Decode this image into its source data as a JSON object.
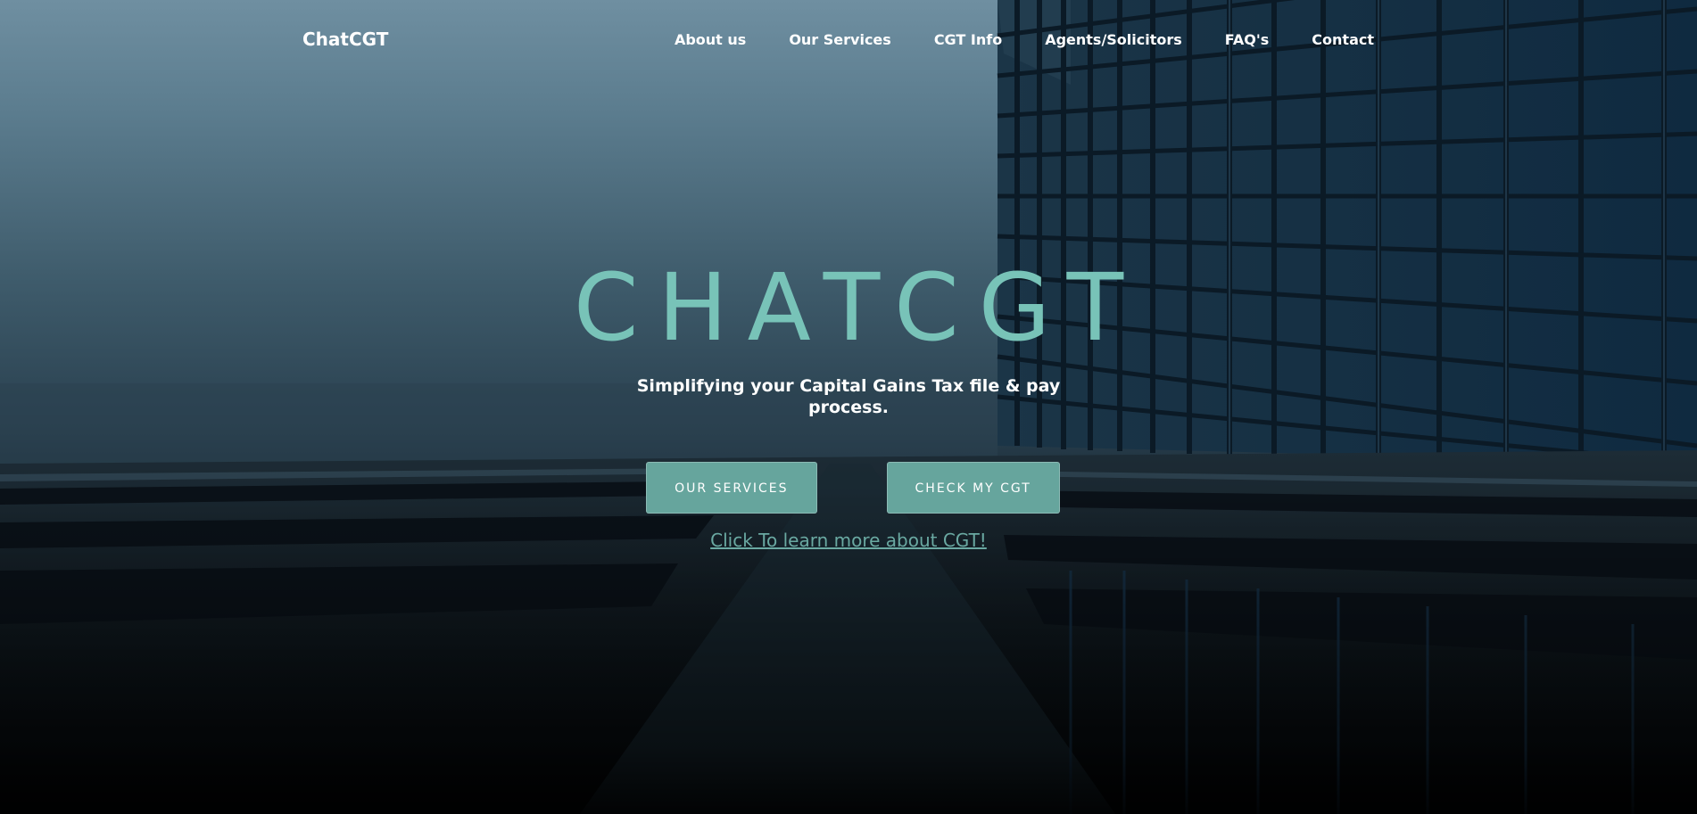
{
  "navbar": {
    "brand": "ChatCGT",
    "links": [
      {
        "label": "About us"
      },
      {
        "label": "Our Services"
      },
      {
        "label": "CGT Info"
      },
      {
        "label": "Agents/Solicitors"
      },
      {
        "label": "FAQ's"
      },
      {
        "label": "Contact"
      }
    ]
  },
  "hero": {
    "title": "CHATCGT",
    "tagline": "Simplifying your Capital Gains Tax file & pay process.",
    "buttons": {
      "services": "OUR SERVICES",
      "check": "CHECK MY CGT"
    },
    "learn_link": "Click To learn more about CGT!"
  },
  "colors": {
    "accent": "#78c3b8",
    "button": "#66a59d",
    "link": "#6aa9a2"
  }
}
